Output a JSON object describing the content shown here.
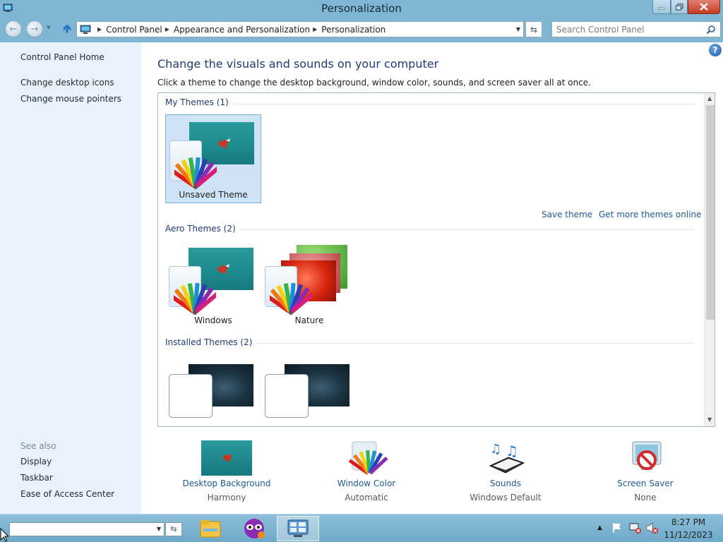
{
  "window": {
    "title": "Personalization"
  },
  "address": {
    "crumbs": [
      "Control Panel",
      "Appearance and Personalization",
      "Personalization"
    ],
    "search_placeholder": "Search Control Panel"
  },
  "sidebar": {
    "home": "Control Panel Home",
    "tasks": [
      "Change desktop icons",
      "Change mouse pointers"
    ],
    "see_also_label": "See also",
    "see_also": [
      "Display",
      "Taskbar",
      "Ease of Access Center"
    ]
  },
  "main": {
    "heading": "Change the visuals and sounds on your computer",
    "subheading": "Click a theme to change the desktop background, window color, sounds, and screen saver all at once.",
    "sections": {
      "my_themes": "My Themes (1)",
      "aero_themes": "Aero Themes (2)",
      "installed_themes": "Installed Themes (2)"
    },
    "my_themes": [
      {
        "name": "Unsaved Theme",
        "selected": true
      }
    ],
    "aero_themes": [
      {
        "name": "Windows"
      },
      {
        "name": "Nature"
      }
    ],
    "installed_themes": [
      {
        "name": ""
      },
      {
        "name": ""
      }
    ],
    "links": {
      "save_theme": "Save theme",
      "get_more": "Get more themes online"
    }
  },
  "bottom": [
    {
      "label": "Desktop Background",
      "value": "Harmony",
      "icon": "desktop-background-icon"
    },
    {
      "label": "Window Color",
      "value": "Automatic",
      "icon": "window-color-icon"
    },
    {
      "label": "Sounds",
      "value": "Windows Default",
      "icon": "sounds-icon"
    },
    {
      "label": "Screen Saver",
      "value": "None",
      "icon": "screen-saver-icon"
    }
  ],
  "taskbar": {
    "apps": [
      "file-explorer-icon",
      "masked-app-icon",
      "control-panel-icon"
    ],
    "time": "8:27 PM",
    "date": "11/12/2023"
  },
  "colors": {
    "titlebar": "#7fb6d3",
    "link": "#1e5aa0",
    "heading": "#1e3b78",
    "selected_tile": "#cfe3f7"
  }
}
